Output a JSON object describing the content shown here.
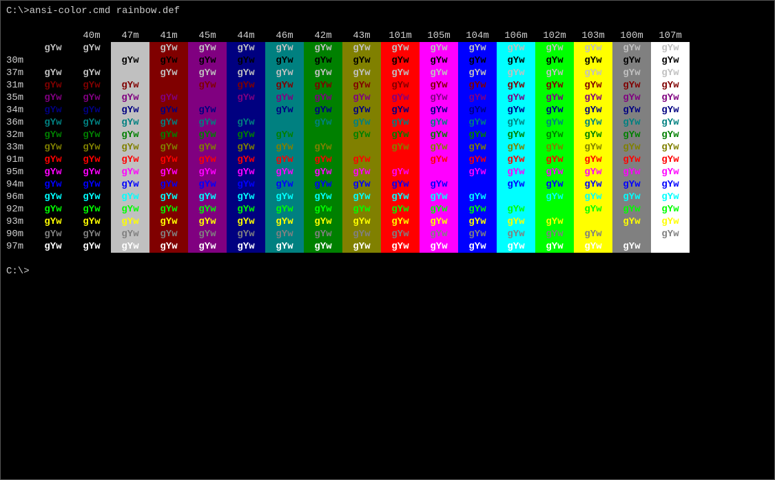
{
  "command_line": "C:\\>ansi-color.cmd rainbow.def",
  "prompt_end": "C:\\>",
  "sample_text": "gYw",
  "bg_columns": [
    {
      "code": "",
      "label": "",
      "bg": ""
    },
    {
      "code": "40m",
      "label": "40m",
      "bg": "#000000"
    },
    {
      "code": "47m",
      "label": "47m",
      "bg": "#c0c0c0"
    },
    {
      "code": "41m",
      "label": "41m",
      "bg": "#800000"
    },
    {
      "code": "45m",
      "label": "45m",
      "bg": "#800080"
    },
    {
      "code": "44m",
      "label": "44m",
      "bg": "#000080"
    },
    {
      "code": "46m",
      "label": "46m",
      "bg": "#008080"
    },
    {
      "code": "42m",
      "label": "42m",
      "bg": "#008000"
    },
    {
      "code": "43m",
      "label": "43m",
      "bg": "#808000"
    },
    {
      "code": "101m",
      "label": "101m",
      "bg": "#ff0000"
    },
    {
      "code": "105m",
      "label": "105m",
      "bg": "#ff00ff"
    },
    {
      "code": "104m",
      "label": "104m",
      "bg": "#0000ff"
    },
    {
      "code": "106m",
      "label": "106m",
      "bg": "#00ffff"
    },
    {
      "code": "102m",
      "label": "102m",
      "bg": "#00ff00"
    },
    {
      "code": "103m",
      "label": "103m",
      "bg": "#ffff00"
    },
    {
      "code": "100m",
      "label": "100m",
      "bg": "#808080"
    },
    {
      "code": "107m",
      "label": "107m",
      "bg": "#ffffff"
    }
  ],
  "fg_rows": [
    {
      "code": "",
      "label": "",
      "fg": "#c0c0c0"
    },
    {
      "code": "30m",
      "label": "30m",
      "fg": "#000000"
    },
    {
      "code": "37m",
      "label": "37m",
      "fg": "#c0c0c0"
    },
    {
      "code": "31m",
      "label": "31m",
      "fg": "#800000"
    },
    {
      "code": "35m",
      "label": "35m",
      "fg": "#800080"
    },
    {
      "code": "34m",
      "label": "34m",
      "fg": "#000080"
    },
    {
      "code": "36m",
      "label": "36m",
      "fg": "#008080"
    },
    {
      "code": "32m",
      "label": "32m",
      "fg": "#008000"
    },
    {
      "code": "33m",
      "label": "33m",
      "fg": "#808000"
    },
    {
      "code": "91m",
      "label": "91m",
      "fg": "#ff0000"
    },
    {
      "code": "95m",
      "label": "95m",
      "fg": "#ff00ff"
    },
    {
      "code": "94m",
      "label": "94m",
      "fg": "#0000ff"
    },
    {
      "code": "96m",
      "label": "96m",
      "fg": "#00ffff"
    },
    {
      "code": "92m",
      "label": "92m",
      "fg": "#00ff00"
    },
    {
      "code": "93m",
      "label": "93m",
      "fg": "#ffff00"
    },
    {
      "code": "90m",
      "label": "90m",
      "fg": "#808080"
    },
    {
      "code": "97m",
      "label": "97m",
      "fg": "#ffffff"
    }
  ],
  "chart_data": {
    "type": "table",
    "title": "ANSI foreground × background color matrix (sample cell text = gYw)",
    "columns_bg_codes": [
      "(none)",
      "40m",
      "47m",
      "41m",
      "45m",
      "44m",
      "46m",
      "42m",
      "43m",
      "101m",
      "105m",
      "104m",
      "106m",
      "102m",
      "103m",
      "100m",
      "107m"
    ],
    "rows_fg_codes": [
      "(none)",
      "30m",
      "37m",
      "31m",
      "35m",
      "34m",
      "36m",
      "32m",
      "33m",
      "91m",
      "95m",
      "94m",
      "96m",
      "92m",
      "93m",
      "90m",
      "97m"
    ],
    "cell_value": "gYw"
  }
}
